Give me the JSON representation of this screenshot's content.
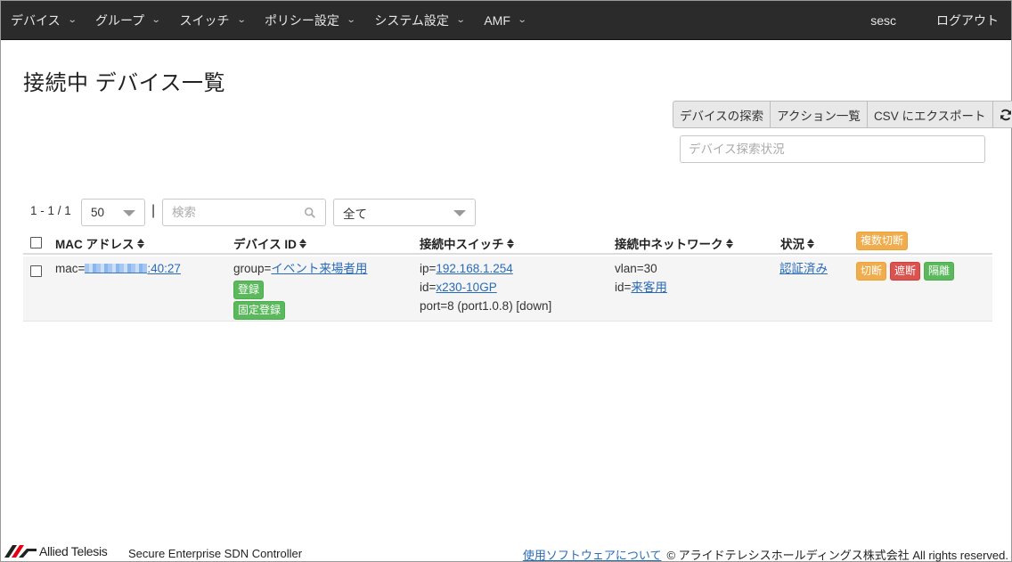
{
  "nav": {
    "items": [
      {
        "label": "デバイス"
      },
      {
        "label": "グループ"
      },
      {
        "label": "スイッチ"
      },
      {
        "label": "ポリシー設定"
      },
      {
        "label": "システム設定"
      },
      {
        "label": "AMF"
      }
    ],
    "user": "sesc",
    "logout": "ログアウト"
  },
  "page": {
    "title": "接続中 デバイス一覧"
  },
  "toolbar": {
    "discover": "デバイスの探索",
    "actions": "アクション一覧",
    "export_csv": "CSV にエクスポート",
    "refresh_icon": "refresh-icon"
  },
  "discovery_status": {
    "placeholder": "デバイス探索状況"
  },
  "filters": {
    "range": "1 - 1 / 1",
    "page_size": "50",
    "separator": "|",
    "search_placeholder": "検索",
    "status_filter": "全て"
  },
  "table": {
    "columns": {
      "mac": "MAC アドレス",
      "device_id": "デバイス ID",
      "switch": "接続中スイッチ",
      "network": "接続中ネットワーク",
      "status": "状況",
      "bulk_disconnect": "複数切断"
    },
    "rows": [
      {
        "mac_prefix": "mac=",
        "mac_suffix": ":40:27",
        "group_prefix": "group=",
        "group_link": "イベント来場者用",
        "register": "登録",
        "fixed_register": "固定登録",
        "ip_prefix": "ip=",
        "ip_link": "192.168.1.254",
        "id_prefix": "id=",
        "id_link": "x230-10GP",
        "port": "port=8 (port1.0.8) [down]",
        "vlan": "vlan=30",
        "net_id_prefix": "id=",
        "net_id_link": "来客用",
        "status": "認証済み",
        "disconnect": "切断",
        "block": "遮断",
        "isolate": "隔離"
      }
    ]
  },
  "footer": {
    "brand": "Allied Telesis",
    "product": "Secure Enterprise SDN Controller",
    "software_link": "使用ソフトウェアについて",
    "copyright": "© アライドテレシスホールディングス株式会社 All rights reserved."
  },
  "colors": {
    "navbar": "#2b2b2b",
    "link": "#2a6bb8",
    "green": "#5cb85c",
    "orange": "#f0ad4e",
    "red": "#d9534f"
  }
}
